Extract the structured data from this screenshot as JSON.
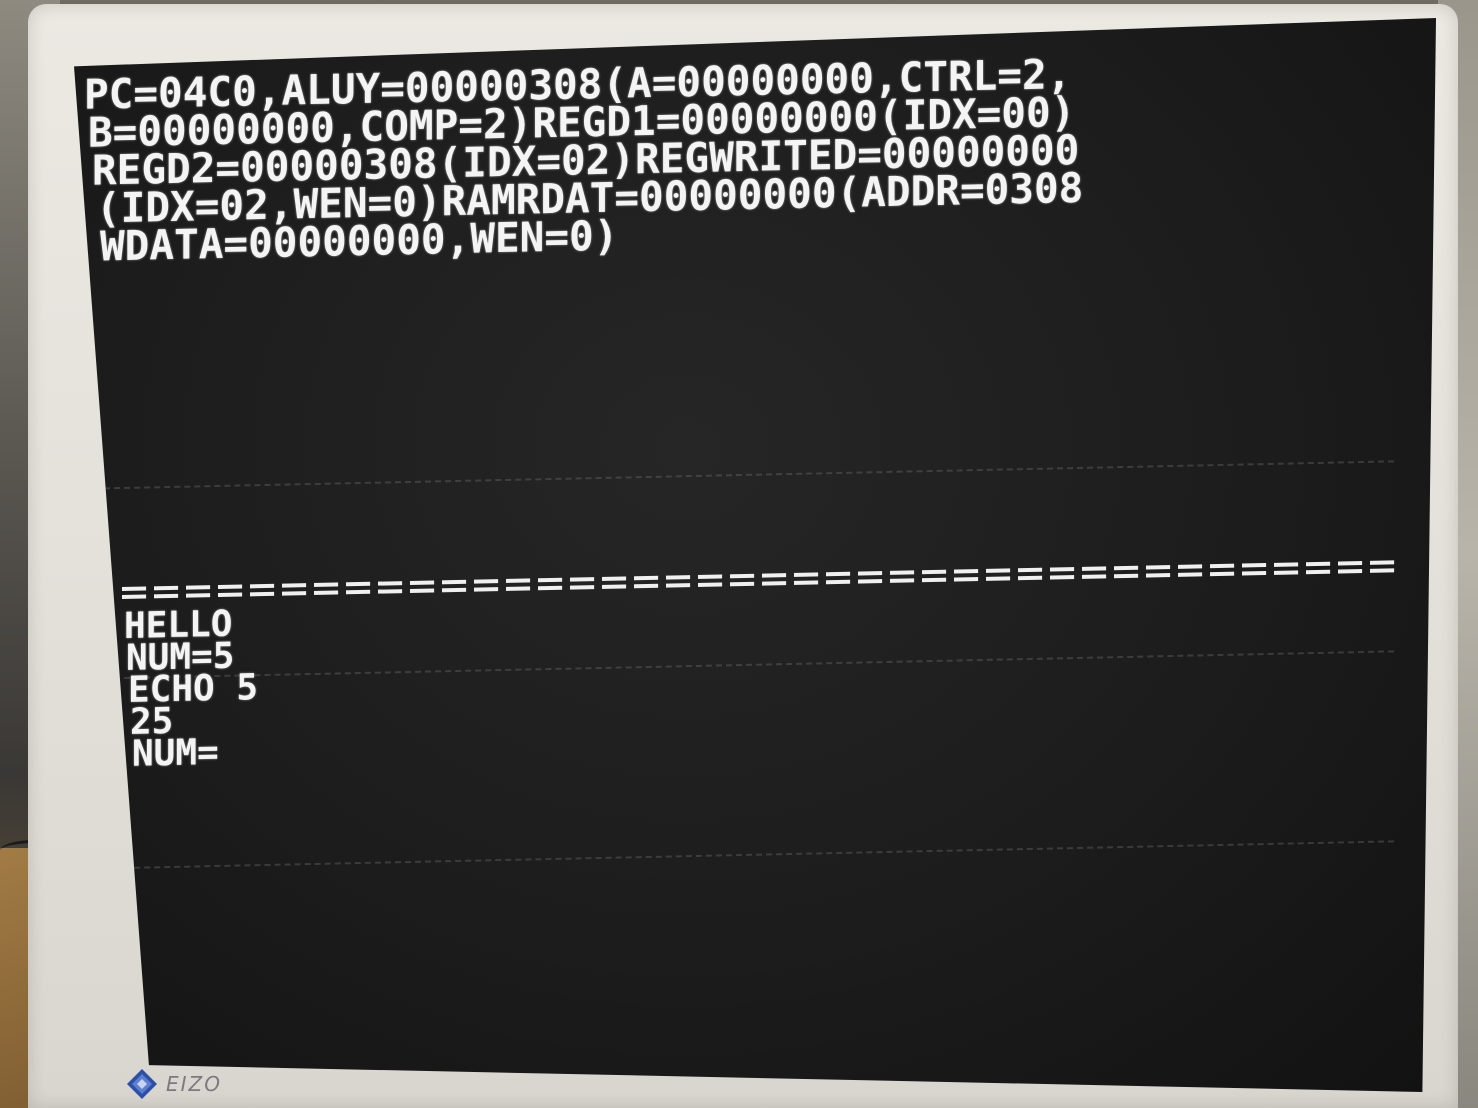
{
  "screen": {
    "debug_lines": [
      "PC=04C0,ALUY=00000308(A=00000000,CTRL=2,",
      "B=00000000,COMP=2)REGD1=00000000(IDX=00)",
      "REGD2=00000308(IDX=02)REGWRITED=00000000",
      "(IDX=02,WEN=0)RAMRDAT=00000000(ADDR=0308",
      "WDATA=00000000,WEN=0)"
    ],
    "separator": "========================================",
    "console_lines": [
      "HELLO",
      "NUM=5",
      "ECHO 5",
      "25",
      "NUM="
    ]
  },
  "monitor": {
    "brand": "EIZO"
  },
  "colors": {
    "text": "#f4f4f4",
    "screen_bg": "#1c1c1c",
    "bezel": "#e6e4dd",
    "logo_blue": "#2e4fa8"
  }
}
